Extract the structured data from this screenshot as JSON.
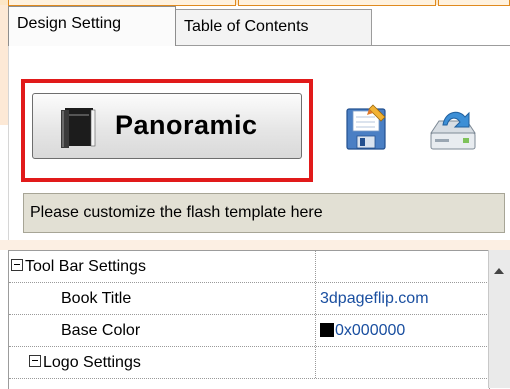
{
  "tabs": [
    {
      "label": "Design Setting",
      "active": true
    },
    {
      "label": "Table of Contents",
      "active": false
    }
  ],
  "template_button": {
    "label": "Panoramic",
    "icon": "book-icon",
    "highlighted": true,
    "highlight_color": "#e11a1a"
  },
  "toolbar_icons": [
    "save-template-icon",
    "export-icon"
  ],
  "hint": "Please customize the flash template here",
  "properties": [
    {
      "name": "Tool Bar Settings",
      "value": "",
      "level": 0,
      "group": true,
      "expanded": true
    },
    {
      "name": "Book Title",
      "value": "3dpageflip.com",
      "level": 1,
      "group": false
    },
    {
      "name": "Base Color",
      "value": "0x000000",
      "level": 1,
      "group": false,
      "swatch": "#000000"
    },
    {
      "name": "Logo Settings",
      "value": "",
      "level": 1,
      "group": true,
      "expanded": true
    }
  ],
  "colors": {
    "value_text": "#1a4fa0",
    "hint_bg": "#e2e0d4",
    "accent_orange": "#e08a1e"
  }
}
